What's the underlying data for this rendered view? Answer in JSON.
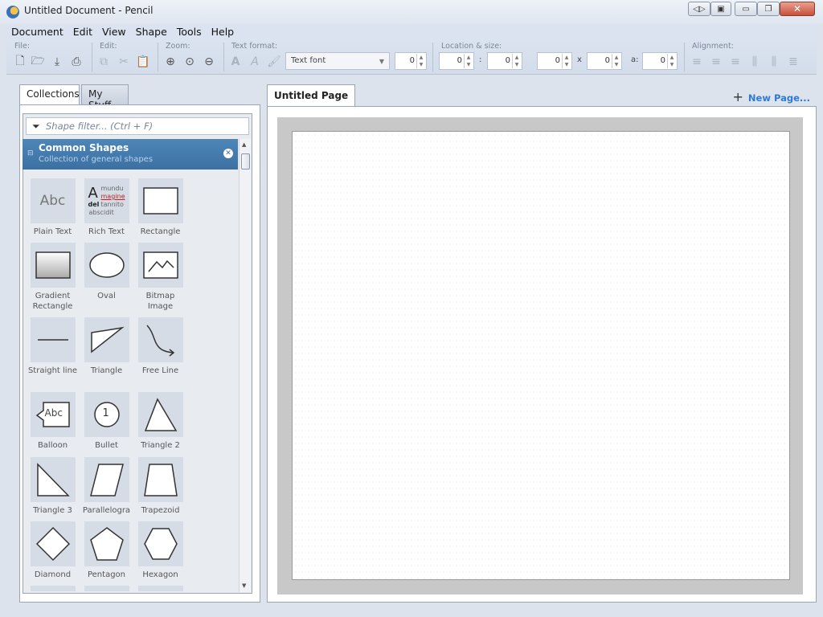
{
  "window": {
    "title": "Untitled Document - Pencil"
  },
  "menu": [
    {
      "label": "Document",
      "key": "D"
    },
    {
      "label": "Edit",
      "key": "E"
    },
    {
      "label": "View",
      "key": "V"
    },
    {
      "label": "Shape",
      "key": "S"
    },
    {
      "label": "Tools",
      "key": "T"
    },
    {
      "label": "Help",
      "key": "H"
    }
  ],
  "toolbar": {
    "file_label": "File:",
    "edit_label": "Edit:",
    "zoom_label": "Zoom:",
    "text_format_label": "Text format:",
    "location_label": "Location & size:",
    "alignment_label": "Alignment:",
    "font_placeholder": "Text font",
    "font_size": "0",
    "loc_x": "0",
    "loc_y": "0",
    "size_w": "0",
    "size_h": "0",
    "angle": "0",
    "colon": ":",
    "times": "x",
    "angle_label": "a:"
  },
  "left_panel": {
    "tabs": [
      "Collections",
      "My Stuff"
    ],
    "filter_placeholder": "Shape filter... (Ctrl + F)",
    "collection_title": "Common Shapes",
    "collection_subtitle": "Collection of general shapes",
    "shapes": [
      {
        "label": "Plain Text",
        "icon": "plain-text-icon"
      },
      {
        "label": "Rich Text",
        "icon": "rich-text-icon"
      },
      {
        "label": "Rectangle",
        "icon": "rectangle-icon"
      },
      {
        "label": "Gradient Rectangle",
        "icon": "gradient-rectangle-icon"
      },
      {
        "label": "Oval",
        "icon": "oval-icon"
      },
      {
        "label": "Bitmap Image",
        "icon": "bitmap-image-icon"
      },
      {
        "label": "Straight line",
        "icon": "straight-line-icon"
      },
      {
        "label": "Triangle",
        "icon": "triangle-icon"
      },
      {
        "label": "Free Line",
        "icon": "free-line-icon"
      },
      {
        "label": "Balloon",
        "icon": "balloon-icon"
      },
      {
        "label": "Bullet",
        "icon": "bullet-icon"
      },
      {
        "label": "Triangle 2",
        "icon": "triangle2-icon"
      },
      {
        "label": "Triangle 3",
        "icon": "triangle3-icon"
      },
      {
        "label": "Parallelogra",
        "icon": "parallelogram-icon"
      },
      {
        "label": "Trapezoid",
        "icon": "trapezoid-icon"
      },
      {
        "label": "Diamond",
        "icon": "diamond-icon"
      },
      {
        "label": "Pentagon",
        "icon": "pentagon-icon"
      },
      {
        "label": "Hexagon",
        "icon": "hexagon-icon"
      }
    ],
    "thumb_text": {
      "abc": "Abc",
      "balloon_abc": "Abc",
      "bullet_num": "1",
      "rich_A": "A",
      "rich_l1": "mundu",
      "rich_l2": "magine",
      "rich_l3": "del",
      "rich_l3b": "tannito",
      "rich_l4": "abscidit"
    }
  },
  "right_panel": {
    "page_tab": "Untitled Page",
    "new_page": "New Page..."
  },
  "colors": {
    "accent": "#3c70a3",
    "link": "#2b7bd4",
    "chrome": "#dde3ec"
  }
}
